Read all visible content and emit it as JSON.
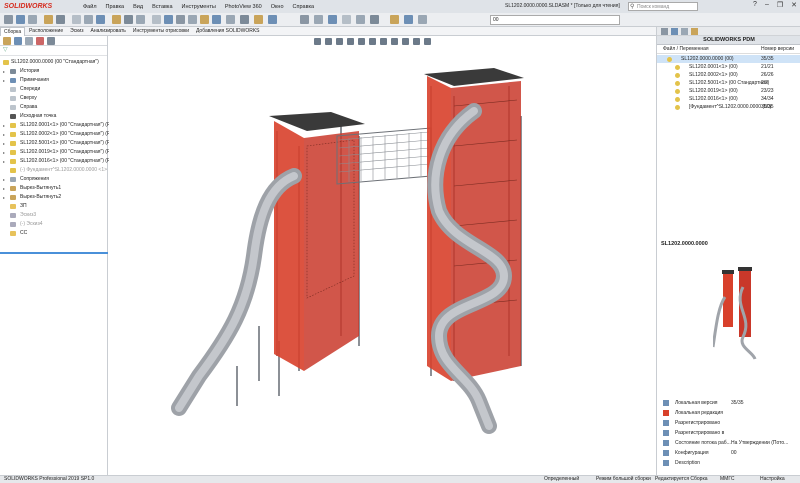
{
  "titlebar": {
    "brand": "SOLIDWORKS",
    "menu": [
      "Файл",
      "Правка",
      "Вид",
      "Вставка",
      "Инструменты",
      "PhotoView 360",
      "Окно",
      "Справка"
    ],
    "document_title": "SL1202.0000.0000.SLDASM * [Только для чтения]",
    "search_placeholder": "Поиск команд"
  },
  "toolbar": {
    "configuration_value": "00"
  },
  "command_tabs": [
    "Сборка",
    "Расположение",
    "Эскиз",
    "Анализировать",
    "Инструменты отрисовки",
    "Добавления SOLIDWORKS"
  ],
  "feature_tree": {
    "root": "SL1202.0000.0000 (00 \"Стандартная\")",
    "items": [
      {
        "label": "История",
        "icon": "history-icon",
        "arrow": "▸"
      },
      {
        "label": "Примечания",
        "icon": "annotations-icon",
        "arrow": "▸"
      },
      {
        "label": "Спереди",
        "icon": "plane-icon",
        "arrow": ""
      },
      {
        "label": "Сверху",
        "icon": "plane-icon",
        "arrow": ""
      },
      {
        "label": "Справа",
        "icon": "plane-icon",
        "arrow": ""
      },
      {
        "label": "Исходная точка",
        "icon": "origin-icon",
        "arrow": ""
      },
      {
        "label": "SL1202.0001<1> (00 \"Стандартная\") (Р",
        "icon": "part-icon",
        "arrow": "▸"
      },
      {
        "label": "SL1202.0002<1> (00 \"Стандартная\") (Р",
        "icon": "part-icon",
        "arrow": "▸"
      },
      {
        "label": "SL1202.5001<1> (00 \"Стандартная\") (Ра",
        "icon": "part-icon",
        "arrow": "▸"
      },
      {
        "label": "SL1202.0019<1> (00 \"Стандартная\") (Р",
        "icon": "part-icon",
        "arrow": "▸"
      },
      {
        "label": "SL1202.0016<1> (00 \"Стандартная\") (Р",
        "icon": "part-icon",
        "arrow": "▸"
      },
      {
        "label": "(-) Фундамент^SL1202.0000.0000 <1>",
        "icon": "part-icon",
        "arrow": "",
        "grey": true
      },
      {
        "label": "Сопряжения",
        "icon": "mates-icon",
        "arrow": "▸"
      },
      {
        "label": "Вырез-Вытянуть1",
        "icon": "cut-icon",
        "arrow": "▸"
      },
      {
        "label": "Вырез-Вытянуть2",
        "icon": "cut-icon",
        "arrow": "▸"
      },
      {
        "label": "ЗП",
        "icon": "folder-icon",
        "arrow": ""
      },
      {
        "label": "Эскиз3",
        "icon": "sketch-icon",
        "arrow": "",
        "grey": true
      },
      {
        "label": "(-) Эскиз4",
        "icon": "sketch-icon",
        "arrow": "",
        "grey": true
      },
      {
        "label": "СС",
        "icon": "folder-icon",
        "arrow": ""
      }
    ]
  },
  "pdm": {
    "header": "SOLIDWORKS PDM",
    "col_file": "Файл / Переменная",
    "col_version": "Номер версии",
    "rows": [
      {
        "name": "SL1202.0000.0000  (00)",
        "version": "35/35",
        "indent": 0
      },
      {
        "name": "SL1202.0001<1>  (00)",
        "version": "21/21",
        "indent": 1
      },
      {
        "name": "SL1202.0002<1>  (00)",
        "version": "26/26",
        "indent": 1
      },
      {
        "name": "SL1202.5001<1>  (00 Стандартная)",
        "version": "2/2",
        "indent": 1
      },
      {
        "name": "SL1202.0019<1>  (00)",
        "version": "23/23",
        "indent": 1
      },
      {
        "name": "SL1202.0016<1>  (00)",
        "version": "34/34",
        "indent": 1
      },
      {
        "name": "[Фундамент^SL1202.0000.0000  (00)",
        "version": "35/35",
        "indent": 1
      }
    ],
    "preview_title": "SL1202.0000.0000",
    "properties": [
      {
        "label": "Локальная версия",
        "value": "35/35",
        "icon": "local-version-icon"
      },
      {
        "label": "Локальная редакция",
        "value": "",
        "icon": "local-revision-icon"
      },
      {
        "label": "Разрегистрировано",
        "value": "",
        "icon": "checked-out-icon"
      },
      {
        "label": "Разрегистрировано в",
        "value": "",
        "icon": "checked-out-in-icon"
      },
      {
        "label": "Состояние потока раб...",
        "value": "На Утверждении (Пото...",
        "icon": "workflow-state-icon"
      },
      {
        "label": "Конфигурация",
        "value": "00",
        "icon": "configuration-icon"
      },
      {
        "label": "Description",
        "value": "",
        "icon": "variable-icon"
      }
    ]
  },
  "statusbar": {
    "left": "SOLIDWORKS Professional 2019 SP1.0",
    "defined": "Определенный",
    "mode": "Режим большой сборки",
    "editing": "Редактируется Сборка",
    "units": "ММГС",
    "settings": "Настройка"
  },
  "colors": {
    "accent_red": "#d8402b",
    "steel": "#a9adb2",
    "brand_red": "#d52b1e",
    "selection_blue": "#cfe3f7"
  }
}
